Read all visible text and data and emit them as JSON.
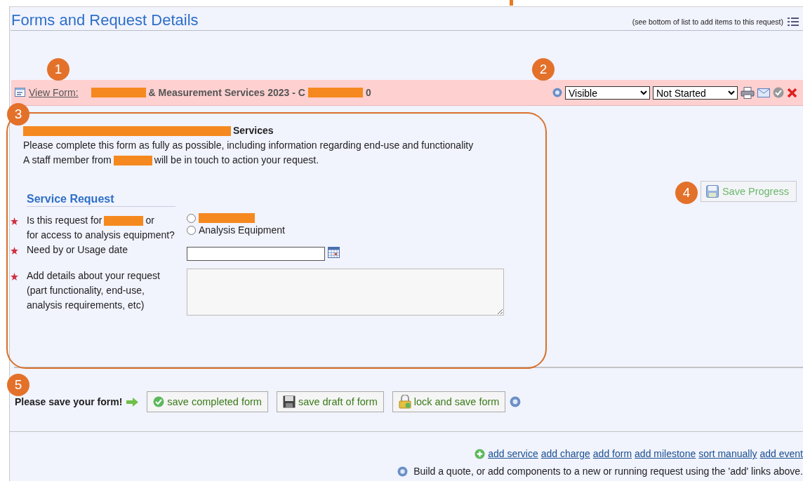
{
  "header": {
    "title": "Forms and Request Details",
    "note": "(see bottom of list to add items to this request)"
  },
  "annotations": [
    "1",
    "2",
    "3",
    "4",
    "5"
  ],
  "form_bar": {
    "link": "View Form:",
    "title": [
      {
        "kind": "redaction"
      },
      {
        "kind": "text",
        "text": "& Measurement Services 2023 - C"
      },
      {
        "kind": "redaction"
      },
      {
        "kind": "text",
        "text": "0"
      }
    ],
    "visibility": "Visible",
    "status": "Not Started"
  },
  "form": {
    "heading": [
      {
        "kind": "redaction"
      },
      {
        "kind": "text",
        "text": "Services"
      }
    ],
    "intro": [
      [
        {
          "kind": "text",
          "text": "Please complete this form as fully as possible, including information regarding end-use and functionality"
        }
      ],
      [
        {
          "kind": "text",
          "text": "A staff member from"
        },
        {
          "kind": "redaction"
        },
        {
          "kind": "text",
          "text": "will be in touch to action your request."
        }
      ]
    ],
    "section": "Service Request",
    "questions": [
      {
        "kind": "radio",
        "required": true,
        "label": [
          {
            "kind": "text",
            "text": "Is this request for"
          },
          {
            "kind": "redaction"
          },
          {
            "kind": "text",
            "text": "or"
          },
          {
            "kind": "text",
            "text": "for access to analysis equipment?"
          }
        ],
        "options": [
          {
            "redacted": true,
            "selected": false
          },
          {
            "redacted": false,
            "label": "Analysis Equipment",
            "selected": false
          }
        ]
      },
      {
        "kind": "date",
        "required": true,
        "label": [
          {
            "kind": "text",
            "text": "Need by or Usage date"
          }
        ]
      },
      {
        "kind": "textarea",
        "required": true,
        "label": [
          {
            "kind": "text",
            "text": "Add details about your request (part functionality, end-use, analysis requirements, etc)"
          }
        ]
      }
    ]
  },
  "save_progress": "Save Progress",
  "save_row": {
    "prompt": "Please save your form!",
    "buttons": [
      {
        "kind": "complete",
        "label": "save completed form"
      },
      {
        "kind": "draft",
        "label": "save draft of form"
      },
      {
        "kind": "lock",
        "label": "lock and save form"
      }
    ]
  },
  "links": [
    "add service",
    "add charge",
    "add form",
    "add milestone",
    "sort manually",
    "add event"
  ],
  "hint": "Build a quote, or add components to a new or running request using the 'add' links above."
}
